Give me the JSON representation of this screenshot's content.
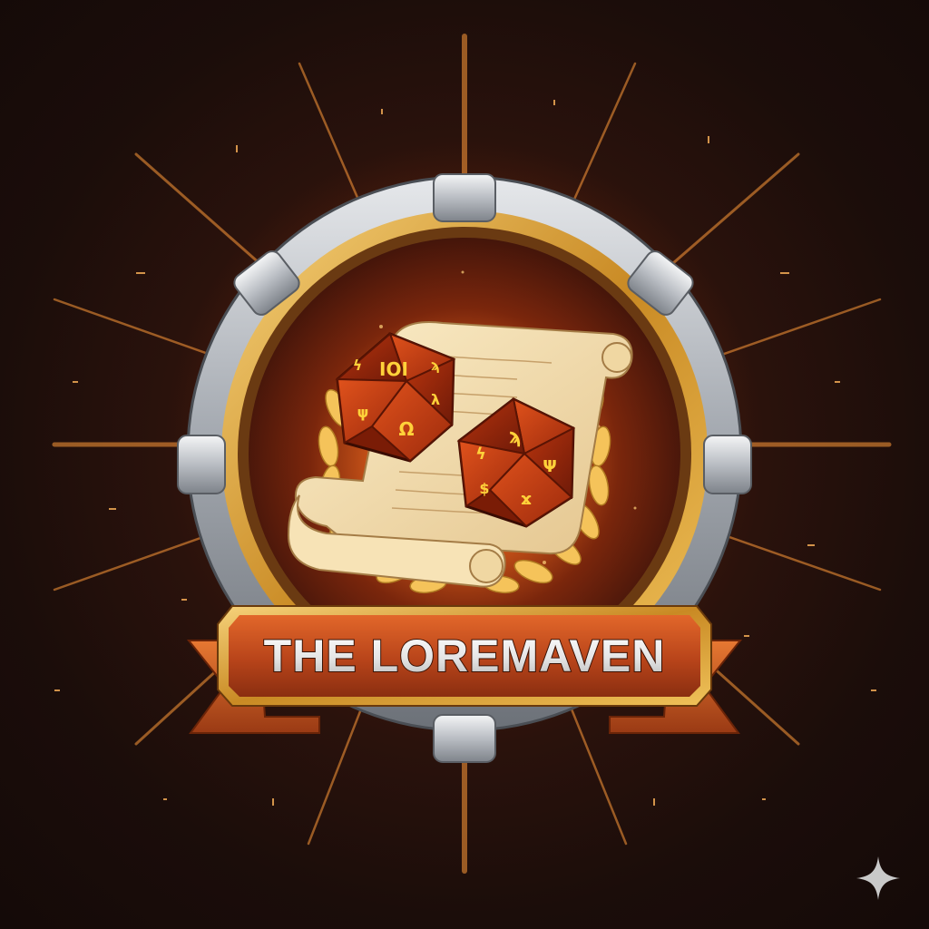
{
  "badge": {
    "title": "THE LOREMAVEN",
    "icon": "d20-dice-and-scroll-emblem",
    "frame": "steel-ring-with-gold-inner-rim",
    "ribbon": "orange-banner"
  },
  "corner_watermark": {
    "icon": "sparkle-icon"
  },
  "colors": {
    "background": "#1a0c08",
    "glow": "#ff7a1a",
    "banner": "#c8501c",
    "banner_border": "#f0b040",
    "title_text": "#eeeeee",
    "dice": "#c53a12",
    "dice_glyph": "#ffd23a",
    "laurel": "#f5c35a",
    "scroll": "#f3dfb4",
    "frame_steel": "#b8bcc2",
    "frame_gold": "#d9a23a"
  }
}
